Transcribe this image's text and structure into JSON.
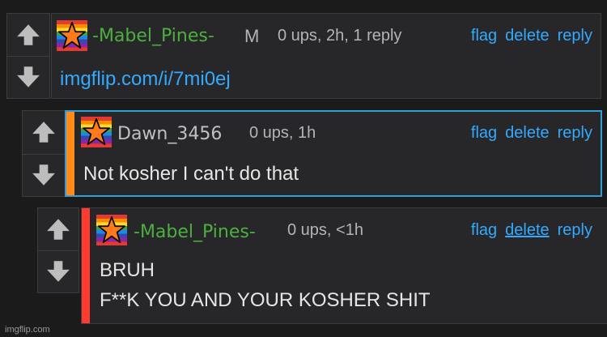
{
  "colors": {
    "background": "#1b1b1c",
    "panel": "#272729",
    "link": "#33aaff",
    "username_green": "#4caf3f",
    "username_gray": "#c0c0c0",
    "accent_orange": "#ff8c1a",
    "accent_red": "#ff3b30",
    "highlight_border": "#2f9edb"
  },
  "icons": {
    "upvote": "up-arrow-icon",
    "downvote": "down-arrow-icon",
    "avatar": "rainbow-star-avatar-icon"
  },
  "comments": [
    {
      "username": "-Mabel_Pines-",
      "badge": "M",
      "meta": "0 ups, 2h, 1 reply",
      "actions": [
        "flag",
        "delete",
        "reply"
      ],
      "text": "imgflip.com/i/7mi0ej"
    },
    {
      "username": "Dawn_3456",
      "meta": "0 ups, 1h",
      "actions": [
        "flag",
        "delete",
        "reply"
      ],
      "text": "Not kosher I can't do that"
    },
    {
      "username": "-Mabel_Pines-",
      "meta": "0 ups, <1h",
      "actions": [
        "flag",
        "delete",
        "reply"
      ],
      "text_line1": "BRUH",
      "text_line2": "F**K YOU AND YOUR KOSHER SHIT"
    }
  ],
  "watermark": "imgflip.com"
}
